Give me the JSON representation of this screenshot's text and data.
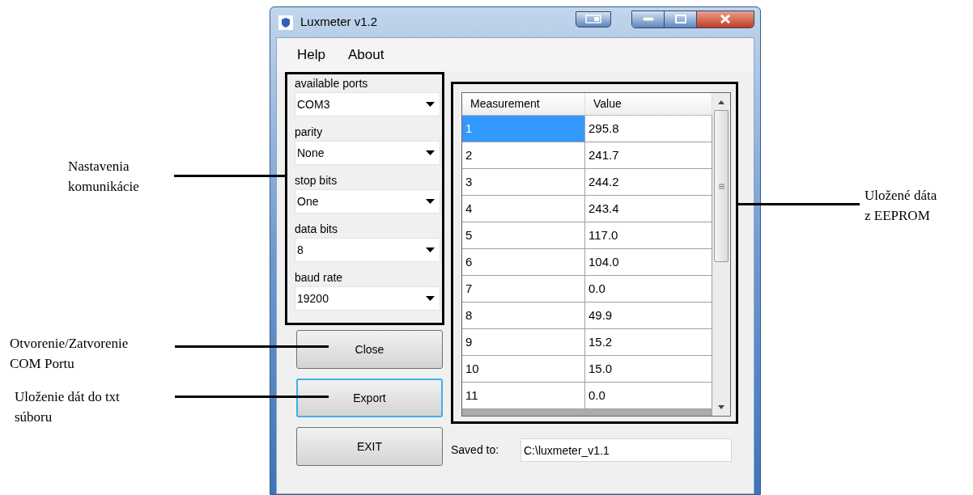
{
  "window": {
    "title": "Luxmeter v1.2"
  },
  "menu": [
    "Help",
    "About"
  ],
  "settings": [
    {
      "label": "available ports",
      "value": "COM3"
    },
    {
      "label": "parity",
      "value": "None"
    },
    {
      "label": "stop bits",
      "value": "One"
    },
    {
      "label": "data bits",
      "value": "8"
    },
    {
      "label": "baud rate",
      "value": "19200"
    }
  ],
  "table": {
    "columns": [
      "Measurement",
      "Value"
    ],
    "rows": [
      {
        "cells": [
          "1",
          "295.8"
        ],
        "selected": true
      },
      {
        "cells": [
          "2",
          "241.7"
        ],
        "selected": false
      },
      {
        "cells": [
          "3",
          "244.2"
        ],
        "selected": false
      },
      {
        "cells": [
          "4",
          "243.4"
        ],
        "selected": false
      },
      {
        "cells": [
          "5",
          "117.0"
        ],
        "selected": false
      },
      {
        "cells": [
          "6",
          "104.0"
        ],
        "selected": false
      },
      {
        "cells": [
          "7",
          "0.0"
        ],
        "selected": false
      },
      {
        "cells": [
          "8",
          "49.9"
        ],
        "selected": false
      },
      {
        "cells": [
          "9",
          "15.2"
        ],
        "selected": false
      },
      {
        "cells": [
          "10",
          "15.0"
        ],
        "selected": false
      },
      {
        "cells": [
          "11",
          "0.0"
        ],
        "selected": false
      }
    ]
  },
  "buttons": [
    {
      "label": "Close",
      "focused": false
    },
    {
      "label": "Export",
      "focused": true
    },
    {
      "label": "EXIT",
      "focused": false
    }
  ],
  "saved_to": {
    "label": "Saved to:",
    "value": "C:\\luxmeter_v1.1"
  },
  "annotations": [
    {
      "lines": [
        "Nastavenia",
        "komunikácie"
      ]
    },
    {
      "lines": [
        "Uložené dáta",
        "z EEPROM"
      ]
    },
    {
      "lines": [
        "Otvorenie/Zatvorenie",
        "COM Portu"
      ]
    },
    {
      "lines": [
        "Uloženie dát do txt",
        "súboru"
      ]
    }
  ]
}
